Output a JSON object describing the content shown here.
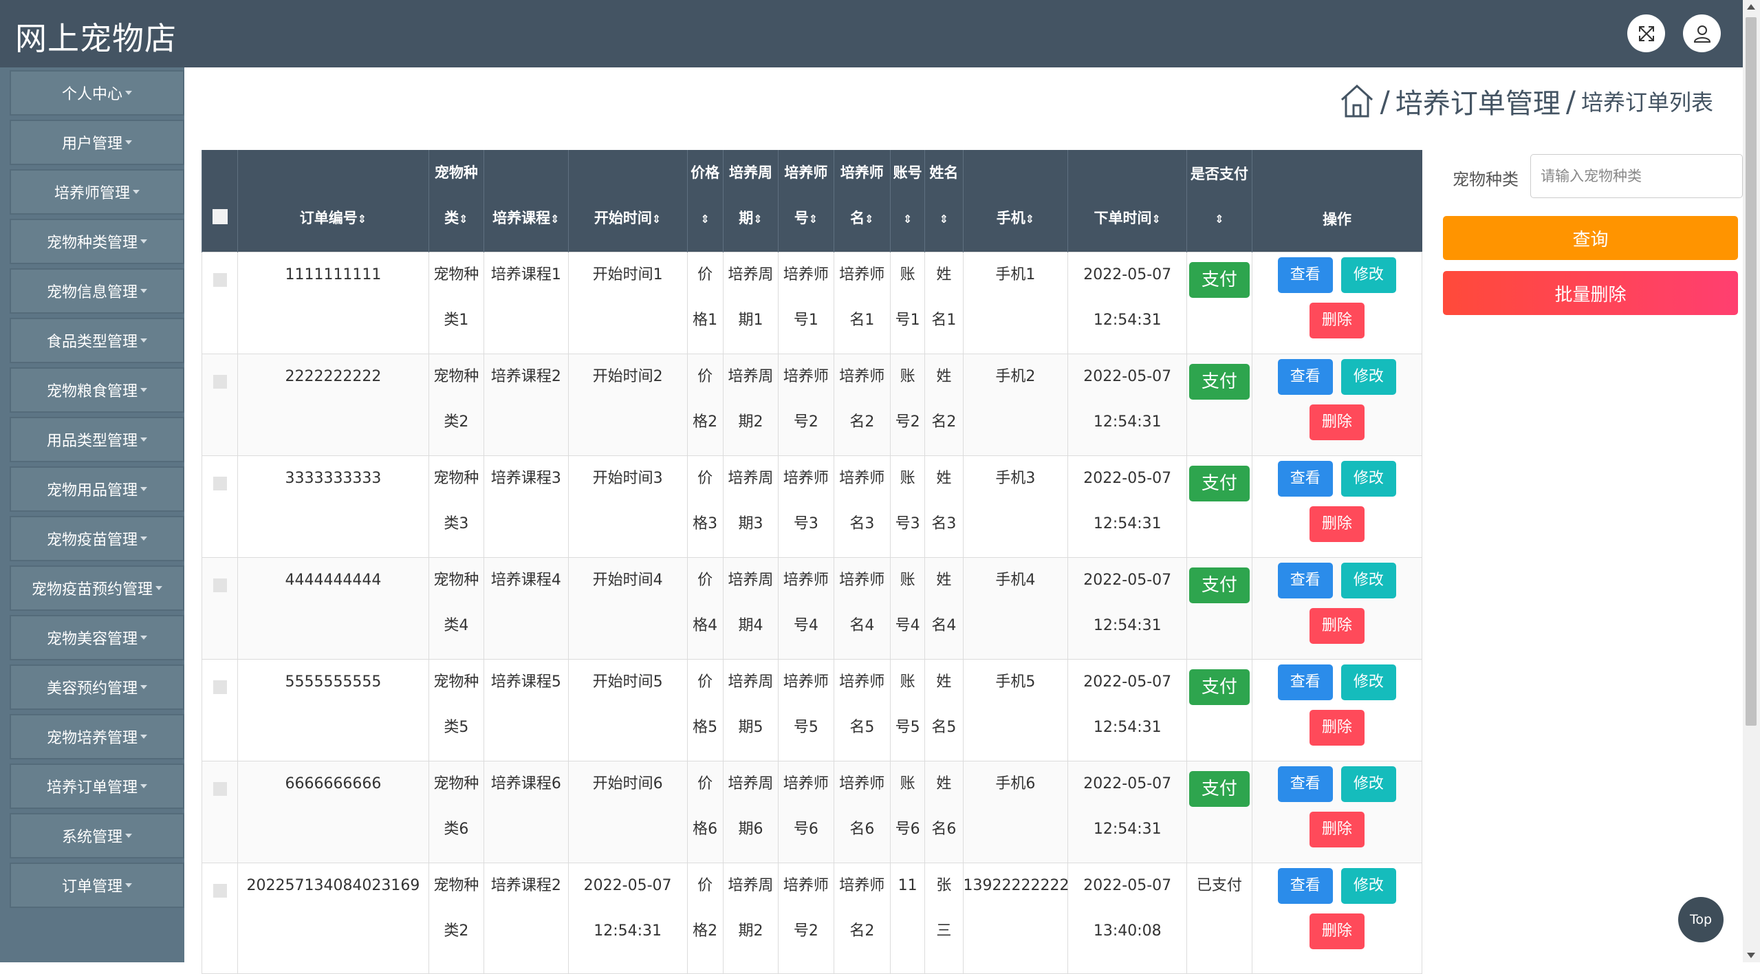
{
  "app": {
    "title": "网上宠物店"
  },
  "header": {
    "fullscreen_icon": "expand-icon",
    "user_icon": "user-icon"
  },
  "sidebar": {
    "items": [
      {
        "label": "个人中心"
      },
      {
        "label": "用户管理"
      },
      {
        "label": "培养师管理"
      },
      {
        "label": "宠物种类管理"
      },
      {
        "label": "宠物信息管理"
      },
      {
        "label": "食品类型管理"
      },
      {
        "label": "宠物粮食管理"
      },
      {
        "label": "用品类型管理"
      },
      {
        "label": "宠物用品管理"
      },
      {
        "label": "宠物疫苗管理"
      },
      {
        "label": "宠物疫苗预约管理"
      },
      {
        "label": "宠物美容管理"
      },
      {
        "label": "美容预约管理"
      },
      {
        "label": "宠物培养管理"
      },
      {
        "label": "培养订单管理"
      },
      {
        "label": "系统管理"
      },
      {
        "label": "订单管理"
      }
    ]
  },
  "breadcrumb": {
    "home_icon": "home-icon",
    "sep": "/",
    "level1": "培养订单管理",
    "level2": "培养订单列表"
  },
  "search": {
    "label": "宠物种类",
    "placeholder": "请输入宠物种类",
    "query_label": "查询",
    "batch_delete_label": "批量删除"
  },
  "table": {
    "headers": {
      "order_no": "订单编号",
      "pet_type_1": "宠物种",
      "pet_type_2": "类",
      "course": "培养课程",
      "start_time": "开始时间",
      "price": "价格",
      "period_1": "培养周",
      "period_2": "期",
      "trainer_no_1": "培养师",
      "trainer_no_2": "号",
      "trainer_name_1": "培养师",
      "trainer_name_2": "名",
      "account": "账号",
      "name": "姓名",
      "phone": "手机",
      "order_time": "下单时间",
      "paid_1": "是否支付",
      "ops": "操作",
      "sort": "⇕"
    },
    "actions": {
      "pay": "支付",
      "view": "查看",
      "edit": "修改",
      "delete": "删除"
    },
    "rows": [
      {
        "order_no": "1111111111",
        "pet_type_a": "宠物种",
        "pet_type_b": "类1",
        "course": "培养课程1",
        "start_a": "开始时间1",
        "start_b": "",
        "price_a": "价",
        "price_b": "格1",
        "period_a": "培养周",
        "period_b": "期1",
        "tno_a": "培养师",
        "tno_b": "号1",
        "tname_a": "培养师",
        "tname_b": "名1",
        "acc_a": "账",
        "acc_b": "号1",
        "name_a": "姓",
        "name_b": "名1",
        "phone": "手机1",
        "otime_a": "2022-05-07",
        "otime_b": "12:54:31",
        "paid": "支付"
      },
      {
        "order_no": "2222222222",
        "pet_type_a": "宠物种",
        "pet_type_b": "类2",
        "course": "培养课程2",
        "start_a": "开始时间2",
        "start_b": "",
        "price_a": "价",
        "price_b": "格2",
        "period_a": "培养周",
        "period_b": "期2",
        "tno_a": "培养师",
        "tno_b": "号2",
        "tname_a": "培养师",
        "tname_b": "名2",
        "acc_a": "账",
        "acc_b": "号2",
        "name_a": "姓",
        "name_b": "名2",
        "phone": "手机2",
        "otime_a": "2022-05-07",
        "otime_b": "12:54:31",
        "paid": "支付"
      },
      {
        "order_no": "3333333333",
        "pet_type_a": "宠物种",
        "pet_type_b": "类3",
        "course": "培养课程3",
        "start_a": "开始时间3",
        "start_b": "",
        "price_a": "价",
        "price_b": "格3",
        "period_a": "培养周",
        "period_b": "期3",
        "tno_a": "培养师",
        "tno_b": "号3",
        "tname_a": "培养师",
        "tname_b": "名3",
        "acc_a": "账",
        "acc_b": "号3",
        "name_a": "姓",
        "name_b": "名3",
        "phone": "手机3",
        "otime_a": "2022-05-07",
        "otime_b": "12:54:31",
        "paid": "支付"
      },
      {
        "order_no": "4444444444",
        "pet_type_a": "宠物种",
        "pet_type_b": "类4",
        "course": "培养课程4",
        "start_a": "开始时间4",
        "start_b": "",
        "price_a": "价",
        "price_b": "格4",
        "period_a": "培养周",
        "period_b": "期4",
        "tno_a": "培养师",
        "tno_b": "号4",
        "tname_a": "培养师",
        "tname_b": "名4",
        "acc_a": "账",
        "acc_b": "号4",
        "name_a": "姓",
        "name_b": "名4",
        "phone": "手机4",
        "otime_a": "2022-05-07",
        "otime_b": "12:54:31",
        "paid": "支付"
      },
      {
        "order_no": "5555555555",
        "pet_type_a": "宠物种",
        "pet_type_b": "类5",
        "course": "培养课程5",
        "start_a": "开始时间5",
        "start_b": "",
        "price_a": "价",
        "price_b": "格5",
        "period_a": "培养周",
        "period_b": "期5",
        "tno_a": "培养师",
        "tno_b": "号5",
        "tname_a": "培养师",
        "tname_b": "名5",
        "acc_a": "账",
        "acc_b": "号5",
        "name_a": "姓",
        "name_b": "名5",
        "phone": "手机5",
        "otime_a": "2022-05-07",
        "otime_b": "12:54:31",
        "paid": "支付"
      },
      {
        "order_no": "6666666666",
        "pet_type_a": "宠物种",
        "pet_type_b": "类6",
        "course": "培养课程6",
        "start_a": "开始时间6",
        "start_b": "",
        "price_a": "价",
        "price_b": "格6",
        "period_a": "培养周",
        "period_b": "期6",
        "tno_a": "培养师",
        "tno_b": "号6",
        "tname_a": "培养师",
        "tname_b": "名6",
        "acc_a": "账",
        "acc_b": "号6",
        "name_a": "姓",
        "name_b": "名6",
        "phone": "手机6",
        "otime_a": "2022-05-07",
        "otime_b": "12:54:31",
        "paid": "支付"
      },
      {
        "order_no": "202257134084023169",
        "pet_type_a": "宠物种",
        "pet_type_b": "类2",
        "course": "培养课程2",
        "start_a": "2022-05-07",
        "start_b": "12:54:31",
        "price_a": "价",
        "price_b": "格2",
        "period_a": "培养周",
        "period_b": "期2",
        "tno_a": "培养师",
        "tno_b": "号2",
        "tname_a": "培养师",
        "tname_b": "名2",
        "acc_a": "11",
        "acc_b": "",
        "name_a": "张",
        "name_b": "三",
        "phone": "13922222222",
        "otime_a": "2022-05-07",
        "otime_b": "13:40:08",
        "paid": "已支付"
      }
    ]
  },
  "back_to_top": "Top",
  "colors": {
    "header_bg": "#445463",
    "sidebar_bg": "#5d7585",
    "pay_green": "#2ea54e",
    "view_blue": "#2b8cea",
    "edit_teal": "#15bcbc",
    "delete_red": "#ff4a5a",
    "query_orange": "#ff9400"
  }
}
